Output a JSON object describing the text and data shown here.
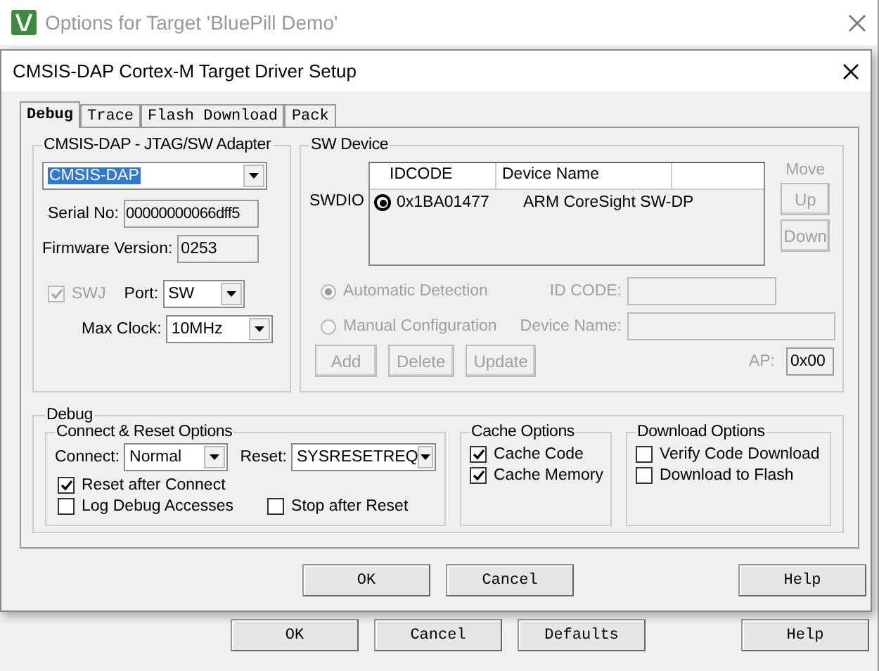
{
  "outer_window": {
    "title": "Options for Target 'BluePill Demo'",
    "buttons": [
      "OK",
      "Cancel",
      "Defaults",
      "Help"
    ]
  },
  "dialog": {
    "title": "CMSIS-DAP Cortex-M Target Driver Setup",
    "tabs": [
      {
        "label": "Debug",
        "selected": true
      },
      {
        "label": "Trace",
        "selected": false
      },
      {
        "label": "Flash Download",
        "selected": false
      },
      {
        "label": "Pack",
        "selected": false
      }
    ],
    "adapter": {
      "title": "CMSIS-DAP - JTAG/SW Adapter",
      "device": "CMSIS-DAP",
      "serial_label": "Serial No:",
      "serial": "00000000066dff5",
      "firmware_label": "Firmware Version:",
      "firmware": "0253",
      "swj": {
        "label": "SWJ",
        "checked": true,
        "disabled": true
      },
      "port_label": "Port:",
      "port": "SW",
      "clock_label": "Max Clock:",
      "clock": "10MHz"
    },
    "sw_device": {
      "title": "SW Device",
      "port_label": "SWDIO",
      "columns": [
        "IDCODE",
        "Device Name"
      ],
      "rows": [
        {
          "idcode": "0x1BA01477",
          "name": "ARM CoreSight SW-DP",
          "selected": true
        }
      ],
      "move_label": "Move",
      "move_buttons": [
        {
          "label": "Up",
          "disabled": true
        },
        {
          "label": "Down",
          "disabled": true
        }
      ],
      "detection": [
        {
          "label": "Automatic Detection",
          "selected": true,
          "disabled": true
        },
        {
          "label": "Manual Configuration",
          "selected": false,
          "disabled": true
        }
      ],
      "id_code_label": "ID CODE:",
      "device_name_label": "Device Name:",
      "buttons": [
        {
          "label": "Add",
          "disabled": true
        },
        {
          "label": "Delete",
          "disabled": true
        },
        {
          "label": "Update",
          "disabled": true
        }
      ],
      "ap_label": "AP:",
      "ap": "0x00"
    },
    "debug": {
      "title": "Debug",
      "connect_reset": {
        "title": "Connect & Reset Options",
        "connect_label": "Connect:",
        "connect": "Normal",
        "reset_label": "Reset:",
        "reset": "SYSRESETREQ",
        "options": [
          {
            "label": "Reset after Connect",
            "checked": true
          },
          {
            "label": "Log Debug Accesses",
            "checked": false
          },
          {
            "label": "Stop after Reset",
            "checked": false
          }
        ]
      },
      "cache": {
        "title": "Cache Options",
        "options": [
          {
            "label": "Cache Code",
            "checked": true
          },
          {
            "label": "Cache Memory",
            "checked": true
          }
        ]
      },
      "download": {
        "title": "Download Options",
        "options": [
          {
            "label": "Verify Code Download",
            "checked": false
          },
          {
            "label": "Download to Flash",
            "checked": false
          }
        ]
      }
    },
    "buttons": [
      "OK",
      "Cancel",
      "Help"
    ]
  }
}
